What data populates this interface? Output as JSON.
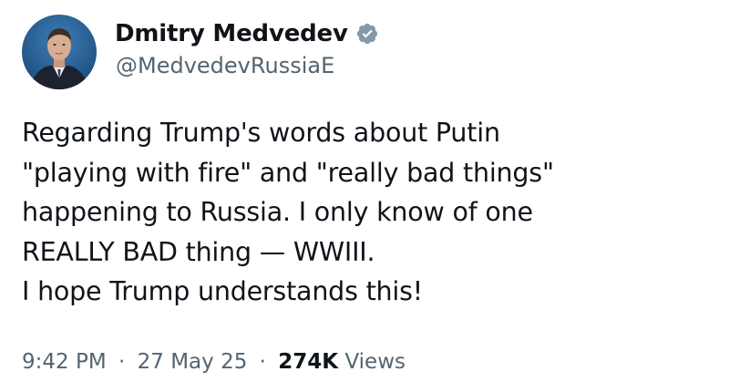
{
  "author": {
    "display_name": "Dmitry Medvedev",
    "handle": "@MedvedevRussiaE",
    "verified_icon": "verified-badge-icon",
    "avatar": "profile-photo"
  },
  "tweet": {
    "lines": [
      "Regarding Trump's words about Putin",
      "\"playing with fire\" and \"really bad things\"",
      "happening to Russia. I only know of one",
      "REALLY BAD thing — WWIII.",
      "I hope Trump understands this!"
    ]
  },
  "meta": {
    "time": "9:42 PM",
    "separator": "·",
    "date": "27 May 25",
    "views_count": "274K",
    "views_label": "Views"
  },
  "colors": {
    "text_primary": "#0f1419",
    "text_secondary": "#536471",
    "verified_badge": "#829aab",
    "background": "#ffffff"
  }
}
